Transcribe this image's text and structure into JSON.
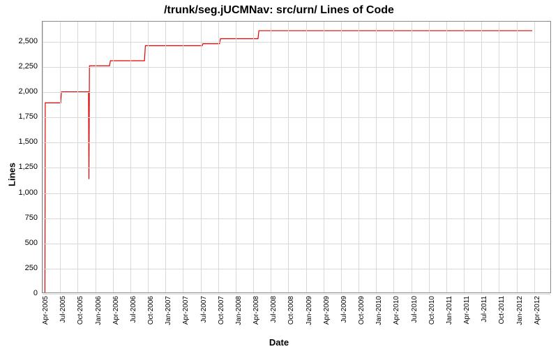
{
  "chart_data": {
    "type": "line",
    "title": "/trunk/seg.jUCMNav: src/urn/ Lines of Code",
    "xlabel": "Date",
    "ylabel": "Lines",
    "ylim": [
      0,
      2700
    ],
    "xlim_index": [
      0,
      29
    ],
    "x_ticks": [
      "Apr-2005",
      "Jul-2005",
      "Oct-2005",
      "Jan-2006",
      "Apr-2006",
      "Jul-2006",
      "Oct-2006",
      "Jan-2007",
      "Apr-2007",
      "Jul-2007",
      "Oct-2007",
      "Jan-2008",
      "Apr-2008",
      "Jul-2008",
      "Oct-2008",
      "Jan-2009",
      "Apr-2009",
      "Jul-2009",
      "Oct-2009",
      "Jan-2010",
      "Apr-2010",
      "Jul-2010",
      "Oct-2010",
      "Jan-2011",
      "Apr-2011",
      "Jul-2011",
      "Oct-2011",
      "Jan-2012",
      "Apr-2012"
    ],
    "y_ticks": [
      0,
      250,
      500,
      750,
      1000,
      1250,
      1500,
      1750,
      2000,
      2250,
      2500
    ],
    "series": [
      {
        "name": "Lines of Code",
        "color": "#e00000",
        "points": [
          {
            "x": 0.1,
            "y": 0
          },
          {
            "x": 0.12,
            "y": 1890
          },
          {
            "x": 1.0,
            "y": 1890
          },
          {
            "x": 1.05,
            "y": 2000
          },
          {
            "x": 2.6,
            "y": 2000
          },
          {
            "x": 2.62,
            "y": 1130
          },
          {
            "x": 2.65,
            "y": 2260
          },
          {
            "x": 3.8,
            "y": 2260
          },
          {
            "x": 3.85,
            "y": 2310
          },
          {
            "x": 5.8,
            "y": 2310
          },
          {
            "x": 5.85,
            "y": 2460
          },
          {
            "x": 9.1,
            "y": 2460
          },
          {
            "x": 9.15,
            "y": 2480
          },
          {
            "x": 10.1,
            "y": 2480
          },
          {
            "x": 10.15,
            "y": 2530
          },
          {
            "x": 12.3,
            "y": 2530
          },
          {
            "x": 12.35,
            "y": 2610
          },
          {
            "x": 28.0,
            "y": 2610
          }
        ]
      }
    ]
  }
}
